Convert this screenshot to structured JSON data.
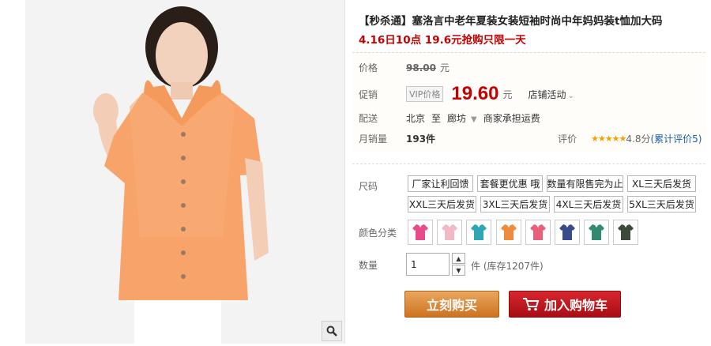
{
  "product": {
    "title": "【秒杀通】塞洛言中老年夏装女装短袖时尚中年妈妈装t恤加大码",
    "subtitle": "4.16日10点 19.6元抢购只限一天"
  },
  "price": {
    "label": "价格",
    "original": "98.00",
    "currency_unit": "元"
  },
  "promo": {
    "label": "促销",
    "vip_tag": "VIP价格",
    "price": "19.60",
    "currency_unit": "元",
    "event": "店铺活动"
  },
  "shipping": {
    "label": "配送",
    "origin": "北京",
    "to": "至",
    "destination": "廊坊",
    "note": "商家承担运费"
  },
  "sales": {
    "label": "月销量",
    "count": "193件",
    "rating_label": "评价",
    "rating_stars": "★★★★★",
    "score": "4.8分",
    "reviews_link": "(累计评价5)"
  },
  "sizes": {
    "label": "尺码",
    "options": [
      "厂家让利回馈",
      "套餐更优惠 哦",
      "数量有限售完为止",
      "XL三天后发货",
      "XXL三天后发货",
      "3XL三天后发货",
      "4XL三天后发货",
      "5XL三天后发货"
    ]
  },
  "colors": {
    "label": "颜色分类",
    "swatches": [
      "#e84a8a",
      "#f2b8c6",
      "#2fa6b4",
      "#f08a3c",
      "#e8607a",
      "#3a4b8c",
      "#2f8a6e",
      "#3b4a3a"
    ]
  },
  "quantity": {
    "label": "数量",
    "value": "1",
    "stock": "件 (库存1207件)"
  },
  "actions": {
    "buy_now": "立刻购买",
    "add_to_cart": "加入购物车"
  }
}
